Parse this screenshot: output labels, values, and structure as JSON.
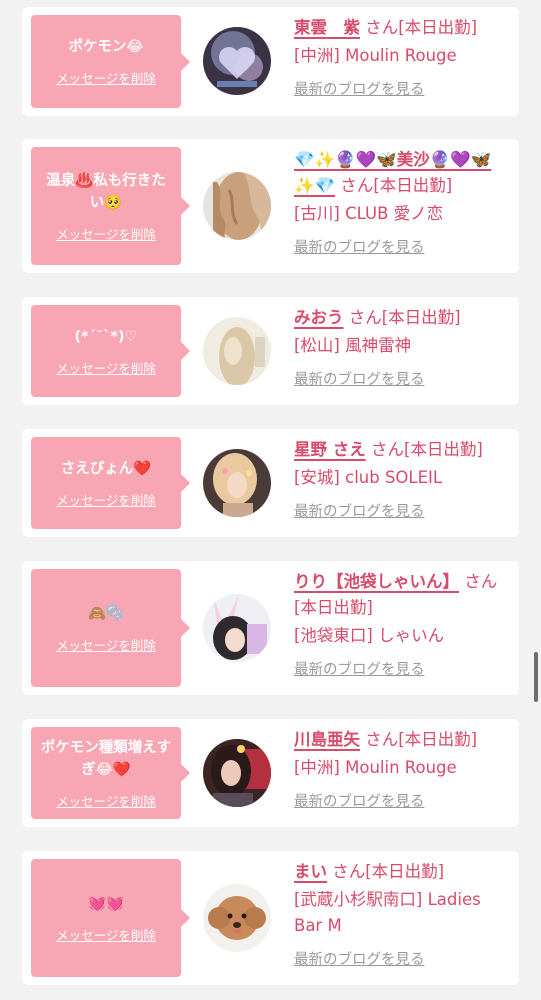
{
  "entries": [
    {
      "message": "ポケモン😂",
      "delete_label": "メッセージを削除",
      "name": "東雲　紫",
      "san": "さん[本日出勤]",
      "shop": "[中洲] Moulin Rouge",
      "blog": "最新のブログを見る",
      "avatar": "avatar-heart-glow"
    },
    {
      "message": "温泉♨️私も行きたい🥺",
      "delete_label": "メッセージを削除",
      "name": "💎✨🔮💜🦋美沙🔮💜🦋✨💎",
      "san": "さん[本日出勤]",
      "shop": "[古川] CLUB 愛ノ恋",
      "blog": "最新のブログを見る",
      "avatar": "avatar-wavy-hair"
    },
    {
      "message": "(*´˘`*)♡",
      "delete_label": "メッセージを削除",
      "name": "みおう",
      "san": "さん[本日出勤]",
      "shop": "[松山] 風神雷神",
      "blog": "最新のブログを見る",
      "avatar": "avatar-light-hair"
    },
    {
      "message": "さえぴょん❤️",
      "delete_label": "メッセージを削除",
      "name": "星野 さえ",
      "san": "さん[本日出勤]",
      "shop": "[安城] club SOLEIL",
      "blog": "最新のブログを見る",
      "avatar": "avatar-blonde"
    },
    {
      "message": "🙈🫧",
      "delete_label": "メッセージを削除",
      "name": "りり【池袋しゃいん】",
      "san": "さん[本日出勤]",
      "shop": "[池袋東口] しゃいん",
      "blog": "最新のブログを見る",
      "avatar": "avatar-bunny-ears"
    },
    {
      "message": "ポケモン種類増えすぎ😂❤️",
      "delete_label": "メッセージを削除",
      "name": "川島亜矢",
      "san": "さん[本日出勤]",
      "shop": "[中洲] Moulin Rouge",
      "blog": "最新のブログを見る",
      "avatar": "avatar-dark-hair"
    },
    {
      "message": "💓💓",
      "delete_label": "メッセージを削除",
      "name": "まい",
      "san": "さん[本日出勤]",
      "shop": "[武蔵小杉駅南口] Ladies Bar M",
      "blog": "最新のブログを見る",
      "avatar": "avatar-poodle"
    }
  ]
}
